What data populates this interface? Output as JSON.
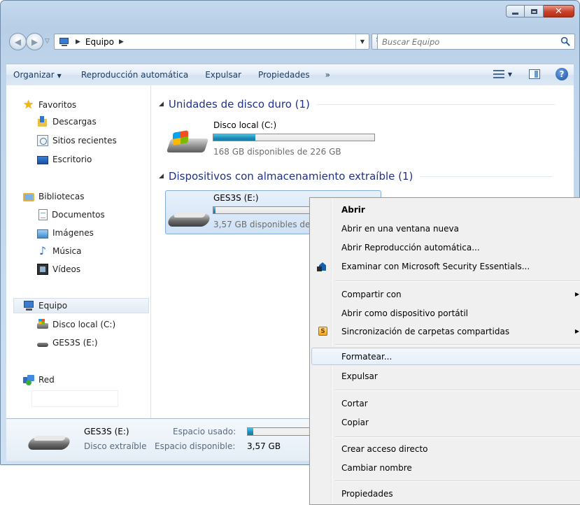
{
  "window": {
    "controls": {
      "minimize": "minimize",
      "maximize": "maximize",
      "close": "✕"
    }
  },
  "nav": {
    "breadcrumb": [
      "Equipo"
    ],
    "search_placeholder": "Buscar Equipo"
  },
  "toolbar": {
    "organize": "Organizar",
    "autoplay": "Reproducción automática",
    "eject": "Expulsar",
    "properties": "Propiedades",
    "more": "»"
  },
  "sidebar": {
    "favorites": "Favoritos",
    "downloads": "Descargas",
    "recent": "Sitios recientes",
    "desktop": "Escritorio",
    "libraries": "Bibliotecas",
    "documents": "Documentos",
    "images": "Imágenes",
    "music": "Música",
    "videos": "Vídeos",
    "computer": "Equipo",
    "local_disk": "Disco local (C:)",
    "usb": "GES3S (E:)",
    "network": "Red"
  },
  "groups": {
    "hard_disks": "Unidades de disco duro (1)",
    "removable": "Dispositivos con almacenamiento extraíble (1)"
  },
  "drives": {
    "c": {
      "name": "Disco local (C:)",
      "free_text": "168 GB disponibles de 226 GB",
      "used_fraction": 0.26
    },
    "e": {
      "name": "GES3S (E:)",
      "free_text": "3,57 GB disponibles de",
      "used_fraction": 0.02
    }
  },
  "details": {
    "name": "GES3S (E:)",
    "type": "Disco extraíble",
    "used_label": "Espacio usado:",
    "free_label": "Espacio disponible:",
    "free_value": "3,57 GB",
    "used_fraction": 0.08
  },
  "context_menu": {
    "open": "Abrir",
    "open_new_window": "Abrir en una ventana nueva",
    "open_autoplay": "Abrir Reproducción automática...",
    "scan_mse": "Examinar con Microsoft Security Essentials...",
    "share_with": "Compartir con",
    "open_portable": "Abrir como dispositivo portátil",
    "sync_shared": "Sincronización de carpetas compartidas",
    "format": "Formatear...",
    "eject": "Expulsar",
    "cut": "Cortar",
    "copy": "Copiar",
    "create_shortcut": "Crear acceso directo",
    "rename": "Cambiar nombre",
    "properties": "Propiedades"
  }
}
